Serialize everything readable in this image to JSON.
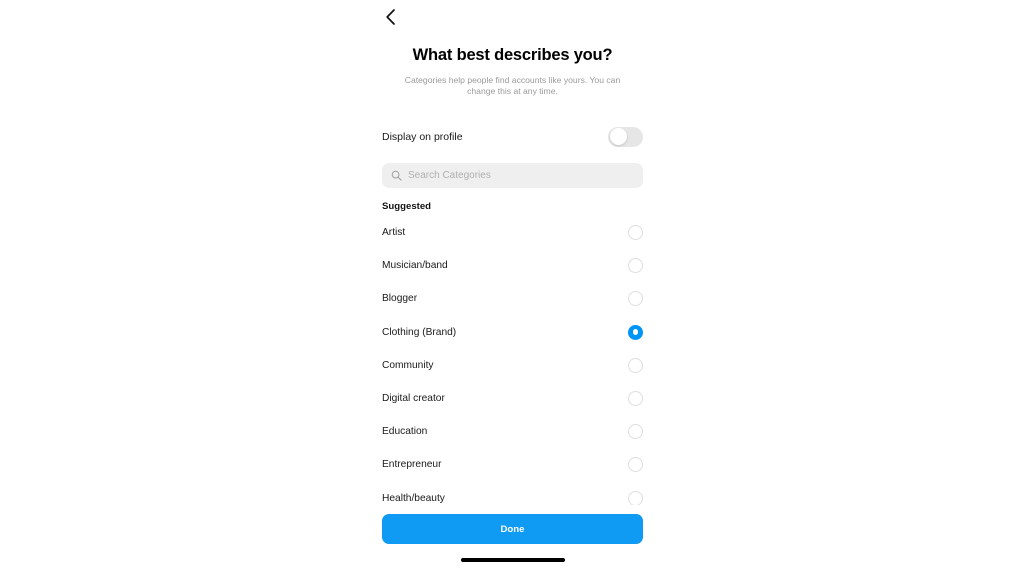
{
  "screen": {
    "back_icon": "chevron-left-icon"
  },
  "header": {
    "title": "What best describes you?",
    "subtitle": "Categories help people find accounts like yours. You can change this at any time."
  },
  "display_toggle": {
    "label": "Display on profile",
    "state": "off"
  },
  "search": {
    "icon": "search-icon",
    "placeholder": "Search Categories",
    "value": ""
  },
  "section": {
    "title": "Suggested"
  },
  "categories": [
    {
      "label": "Artist",
      "selected": false
    },
    {
      "label": "Musician/band",
      "selected": false
    },
    {
      "label": "Blogger",
      "selected": false
    },
    {
      "label": "Clothing (Brand)",
      "selected": true
    },
    {
      "label": "Community",
      "selected": false
    },
    {
      "label": "Digital creator",
      "selected": false
    },
    {
      "label": "Education",
      "selected": false
    },
    {
      "label": "Entrepreneur",
      "selected": false
    },
    {
      "label": "Health/beauty",
      "selected": false
    }
  ],
  "footer": {
    "done_label": "Done"
  },
  "colors": {
    "accent": "#0095f6",
    "button": "#0f9bf4",
    "search_bg": "#efefef",
    "toggle_track_off": "#e6e6e6",
    "radio_border": "#dedede",
    "subtitle_text": "#9a9a9a"
  }
}
